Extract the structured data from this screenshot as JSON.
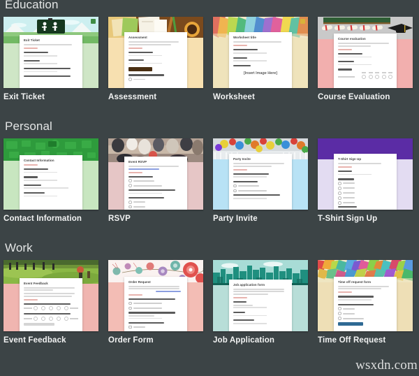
{
  "background_color": "#3c4446",
  "text_color": "#f2f3f3",
  "watermark": "wsxdn.com",
  "sections": [
    {
      "title": "Education",
      "templates": [
        {
          "label": "Exit Ticket",
          "preview_title": "Exit Ticket",
          "banner": "green-hills-exit-sign",
          "banner_color": "#8bc98a",
          "body_color": "#cfe6c6"
        },
        {
          "label": "Assessment",
          "preview_title": "Assessment",
          "banner": "desk-coffee-notebooks",
          "banner_color": "#8a5a2b",
          "body_color": "#f7e0b0"
        },
        {
          "label": "Worksheet",
          "preview_title": "Worksheet title",
          "banner": "colorful-paint-splash",
          "banner_color": "#7fc6a0",
          "body_color": "#efe3bb",
          "placeholder_text": "[Insert Image Here]"
        },
        {
          "label": "Course Evaluation",
          "preview_title": "Course evaluation",
          "banner": "diplomas-graduation-cap",
          "banner_color": "#b9b9b9",
          "body_color": "#f2afae"
        }
      ]
    },
    {
      "title": "Personal",
      "templates": [
        {
          "label": "Contact Information",
          "preview_title": "Contact Information",
          "banner": "green-address-book-pattern",
          "banner_color": "#2e9b3c",
          "body_color": "#c8e6c0"
        },
        {
          "label": "RSVP",
          "preview_title": "Event RSVP",
          "banner": "people-party-photo",
          "banner_color": "#7a6a62",
          "body_color": "#e6c6c6"
        },
        {
          "label": "Party Invite",
          "preview_title": "Party Invite",
          "banner": "balloons-photo",
          "banner_color": "#c8cdd0",
          "body_color": "#b8e2f5"
        },
        {
          "label": "T-Shirt Sign Up",
          "preview_title": "T-Shirt Sign Up",
          "banner": "solid-purple",
          "banner_color": "#5b2ca5",
          "body_color": "#e3dcf2"
        }
      ]
    },
    {
      "title": "Work",
      "templates": [
        {
          "label": "Event Feedback",
          "preview_title": "Event Feedback",
          "banner": "outdoor-field-people-photo",
          "banner_color": "#6f8f3a",
          "body_color": "#f0b5b0"
        },
        {
          "label": "Order Form",
          "preview_title": "Order Request",
          "banner": "floral-illustration",
          "banner_color": "#f7eceb",
          "body_color": "#f3bdb5"
        },
        {
          "label": "Job Application",
          "preview_title": "Job application form",
          "banner": "city-skyline-teal",
          "banner_color": "#1f8f7f",
          "body_color": "#b8ded8"
        },
        {
          "label": "Time Off Request",
          "preview_title": "Time off request form",
          "banner": "colorful-mosaic",
          "banner_color": "#7fb25f",
          "body_color": "#eedfb6"
        }
      ]
    }
  ]
}
